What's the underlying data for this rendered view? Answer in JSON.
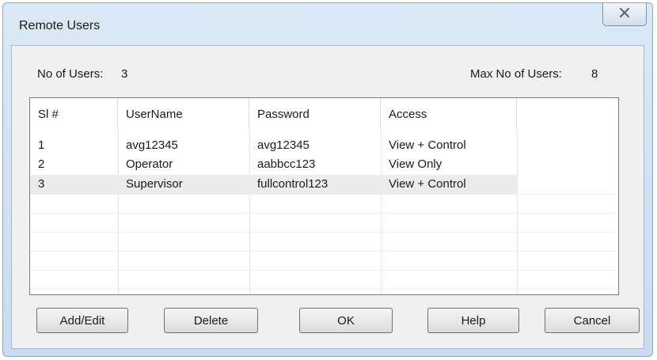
{
  "window": {
    "title": "Remote Users",
    "close_label": "X"
  },
  "info": {
    "users_label": "No of Users:",
    "users_value": "3",
    "max_label": "Max No of Users:",
    "max_value": "8"
  },
  "table": {
    "columns": [
      "Sl #",
      "UserName",
      "Password",
      "Access"
    ],
    "rows": [
      [
        "1",
        "avg12345",
        "avg12345",
        "View + Control"
      ],
      [
        "2",
        "Operator",
        "aabbcc123",
        "View Only"
      ],
      [
        "3",
        "Supervisor",
        "fullcontrol123",
        "View + Control"
      ]
    ]
  },
  "buttons": {
    "add_edit": "Add/Edit",
    "delete": "Delete",
    "ok": "OK",
    "help": "Help",
    "cancel": "Cancel"
  }
}
